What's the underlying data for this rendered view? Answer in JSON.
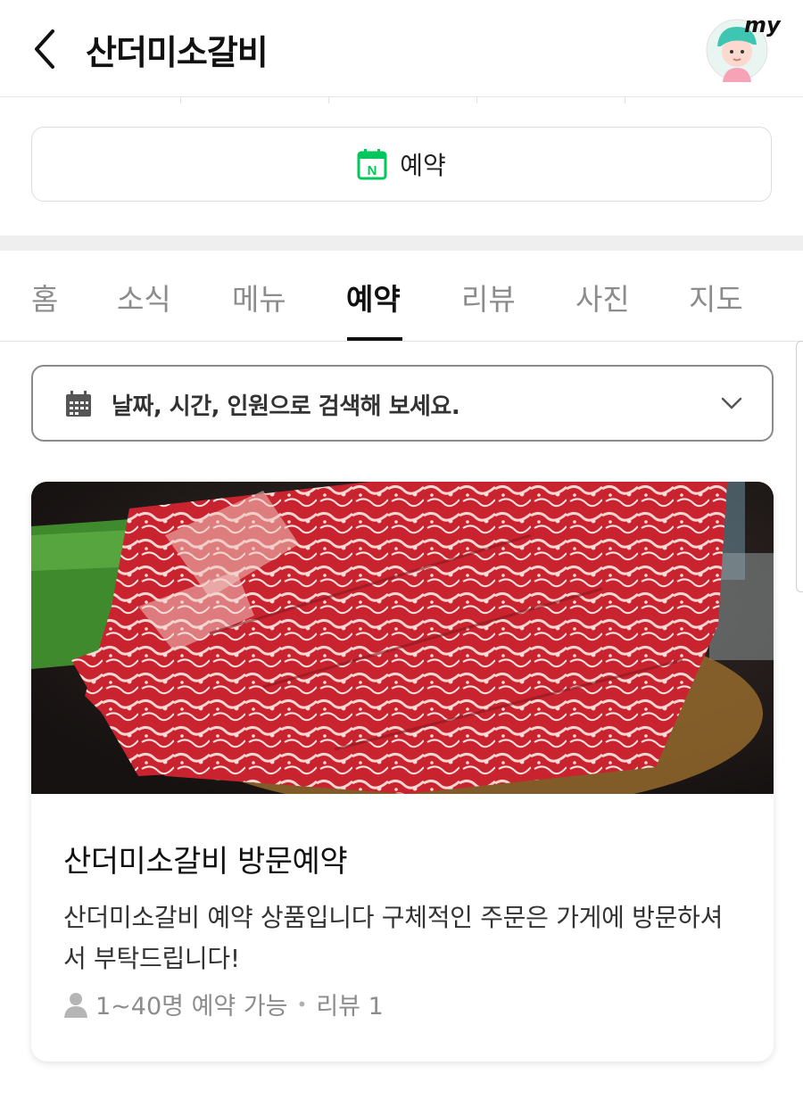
{
  "header": {
    "title": "산더미소갈비",
    "avatar_label": "my"
  },
  "reserve_button": {
    "label": "예약",
    "icon_letter": "N"
  },
  "tabs": [
    {
      "label": "홈"
    },
    {
      "label": "소식"
    },
    {
      "label": "메뉴"
    },
    {
      "label": "예약",
      "active": true
    },
    {
      "label": "리뷰"
    },
    {
      "label": "사진"
    },
    {
      "label": "지도"
    }
  ],
  "search": {
    "placeholder": "날짜, 시간, 인원으로 검색해 보세요."
  },
  "card": {
    "title": "산더미소갈비 방문예약",
    "description": "산더미소갈비 예약 상품입니다 구체적인 주문은 가게에 방문하셔서 부탁드립니다!",
    "capacity": "1~40명 예약 가능",
    "review": "리뷰 1"
  },
  "colors": {
    "accent_green": "#03c75a",
    "active_tab": "#111111",
    "inactive_tab": "#8c8c8c"
  }
}
